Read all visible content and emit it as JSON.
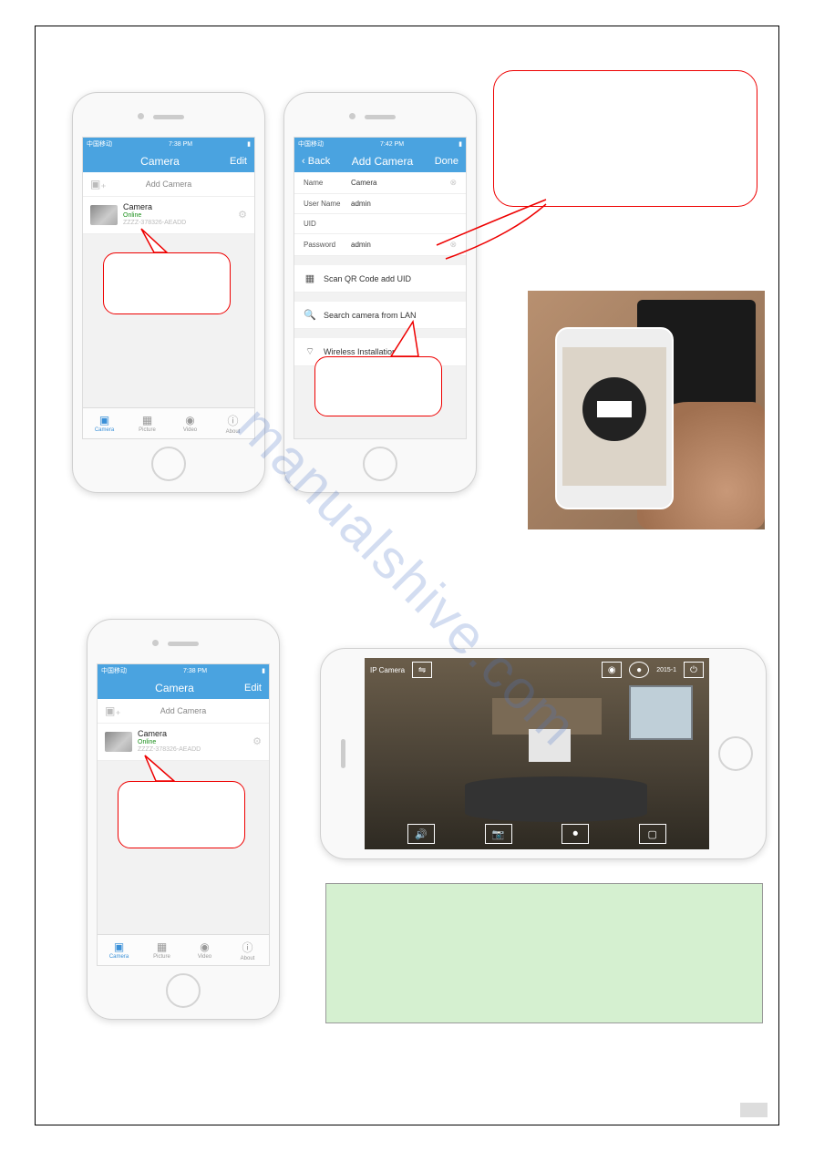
{
  "watermark": "manualshive.com",
  "phone1": {
    "status": {
      "carrier": "中国移动 ⁠",
      "time": "7:38 PM"
    },
    "nav": {
      "title": "Camera",
      "right": "Edit"
    },
    "add_camera_label": "Add Camera",
    "camera": {
      "name": "Camera",
      "status": "Online",
      "uid": "ZZZZ-378326-AEADD"
    },
    "tabs": {
      "camera": "Camera",
      "picture": "Picture",
      "video": "Video",
      "about": "About"
    }
  },
  "phone2": {
    "status": {
      "carrier": "中国移动 ⁠",
      "time": "7:42 PM"
    },
    "nav": {
      "back": "Back",
      "title": "Add Camera",
      "right": "Done"
    },
    "fields": {
      "name_label": "Name",
      "name_value": "Camera",
      "user_label": "User Name",
      "user_value": "admin",
      "uid_label": "UID",
      "uid_value": "",
      "pwd_label": "Password",
      "pwd_value": "admin"
    },
    "options": {
      "scan_qr": "Scan QR Code add UID",
      "search_lan": "Search camera from LAN",
      "wireless": "Wireless Installation"
    }
  },
  "phone3": {
    "status": {
      "carrier": "中国移动 ⁠",
      "time": "7:38 PM"
    },
    "nav": {
      "title": "Camera",
      "right": "Edit"
    },
    "add_camera_label": "Add Camera",
    "camera": {
      "name": "Camera",
      "status": "Online",
      "uid": "ZZZZ-378326-AEADD"
    },
    "tabs": {
      "camera": "Camera",
      "picture": "Picture",
      "video": "Video",
      "about": "About"
    }
  },
  "live": {
    "title": "IP Camera",
    "timestamp": "2015-1"
  }
}
